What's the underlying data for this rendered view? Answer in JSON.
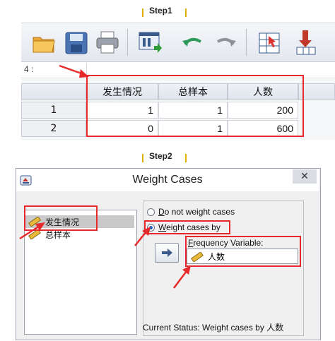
{
  "steps": {
    "step1": "Step1",
    "step2": "Step2"
  },
  "toolbar": {
    "icons": [
      "open-folder-icon",
      "save-icon",
      "print-icon",
      "recall-dialog-icon",
      "undo-icon",
      "redo-icon",
      "goto-case-icon",
      "insert-icon"
    ]
  },
  "cell_reference": "4 :",
  "table": {
    "columns": [
      "发生情况",
      "总样本",
      "人数"
    ],
    "rows": [
      {
        "row_num": "1",
        "cells": [
          "1",
          "1",
          "200"
        ]
      },
      {
        "row_num": "2",
        "cells": [
          "0",
          "1",
          "600"
        ]
      }
    ]
  },
  "dialog": {
    "title": "Weight Cases",
    "close_symbol": "✕",
    "variables": [
      "发生情况",
      "总样本"
    ],
    "options": {
      "do_not_weight": {
        "underlined": "D",
        "rest": "o not weight cases"
      },
      "weight_by": {
        "underlined": "W",
        "rest": "eight cases by"
      }
    },
    "frequency_label": {
      "underlined": "F",
      "rest": "requency Variable:"
    },
    "frequency_value": "人数",
    "status_text": "Current Status: Weight cases by 人数"
  },
  "colors": {
    "highlight": "#e8292b",
    "step_tick": "#e0b000"
  }
}
